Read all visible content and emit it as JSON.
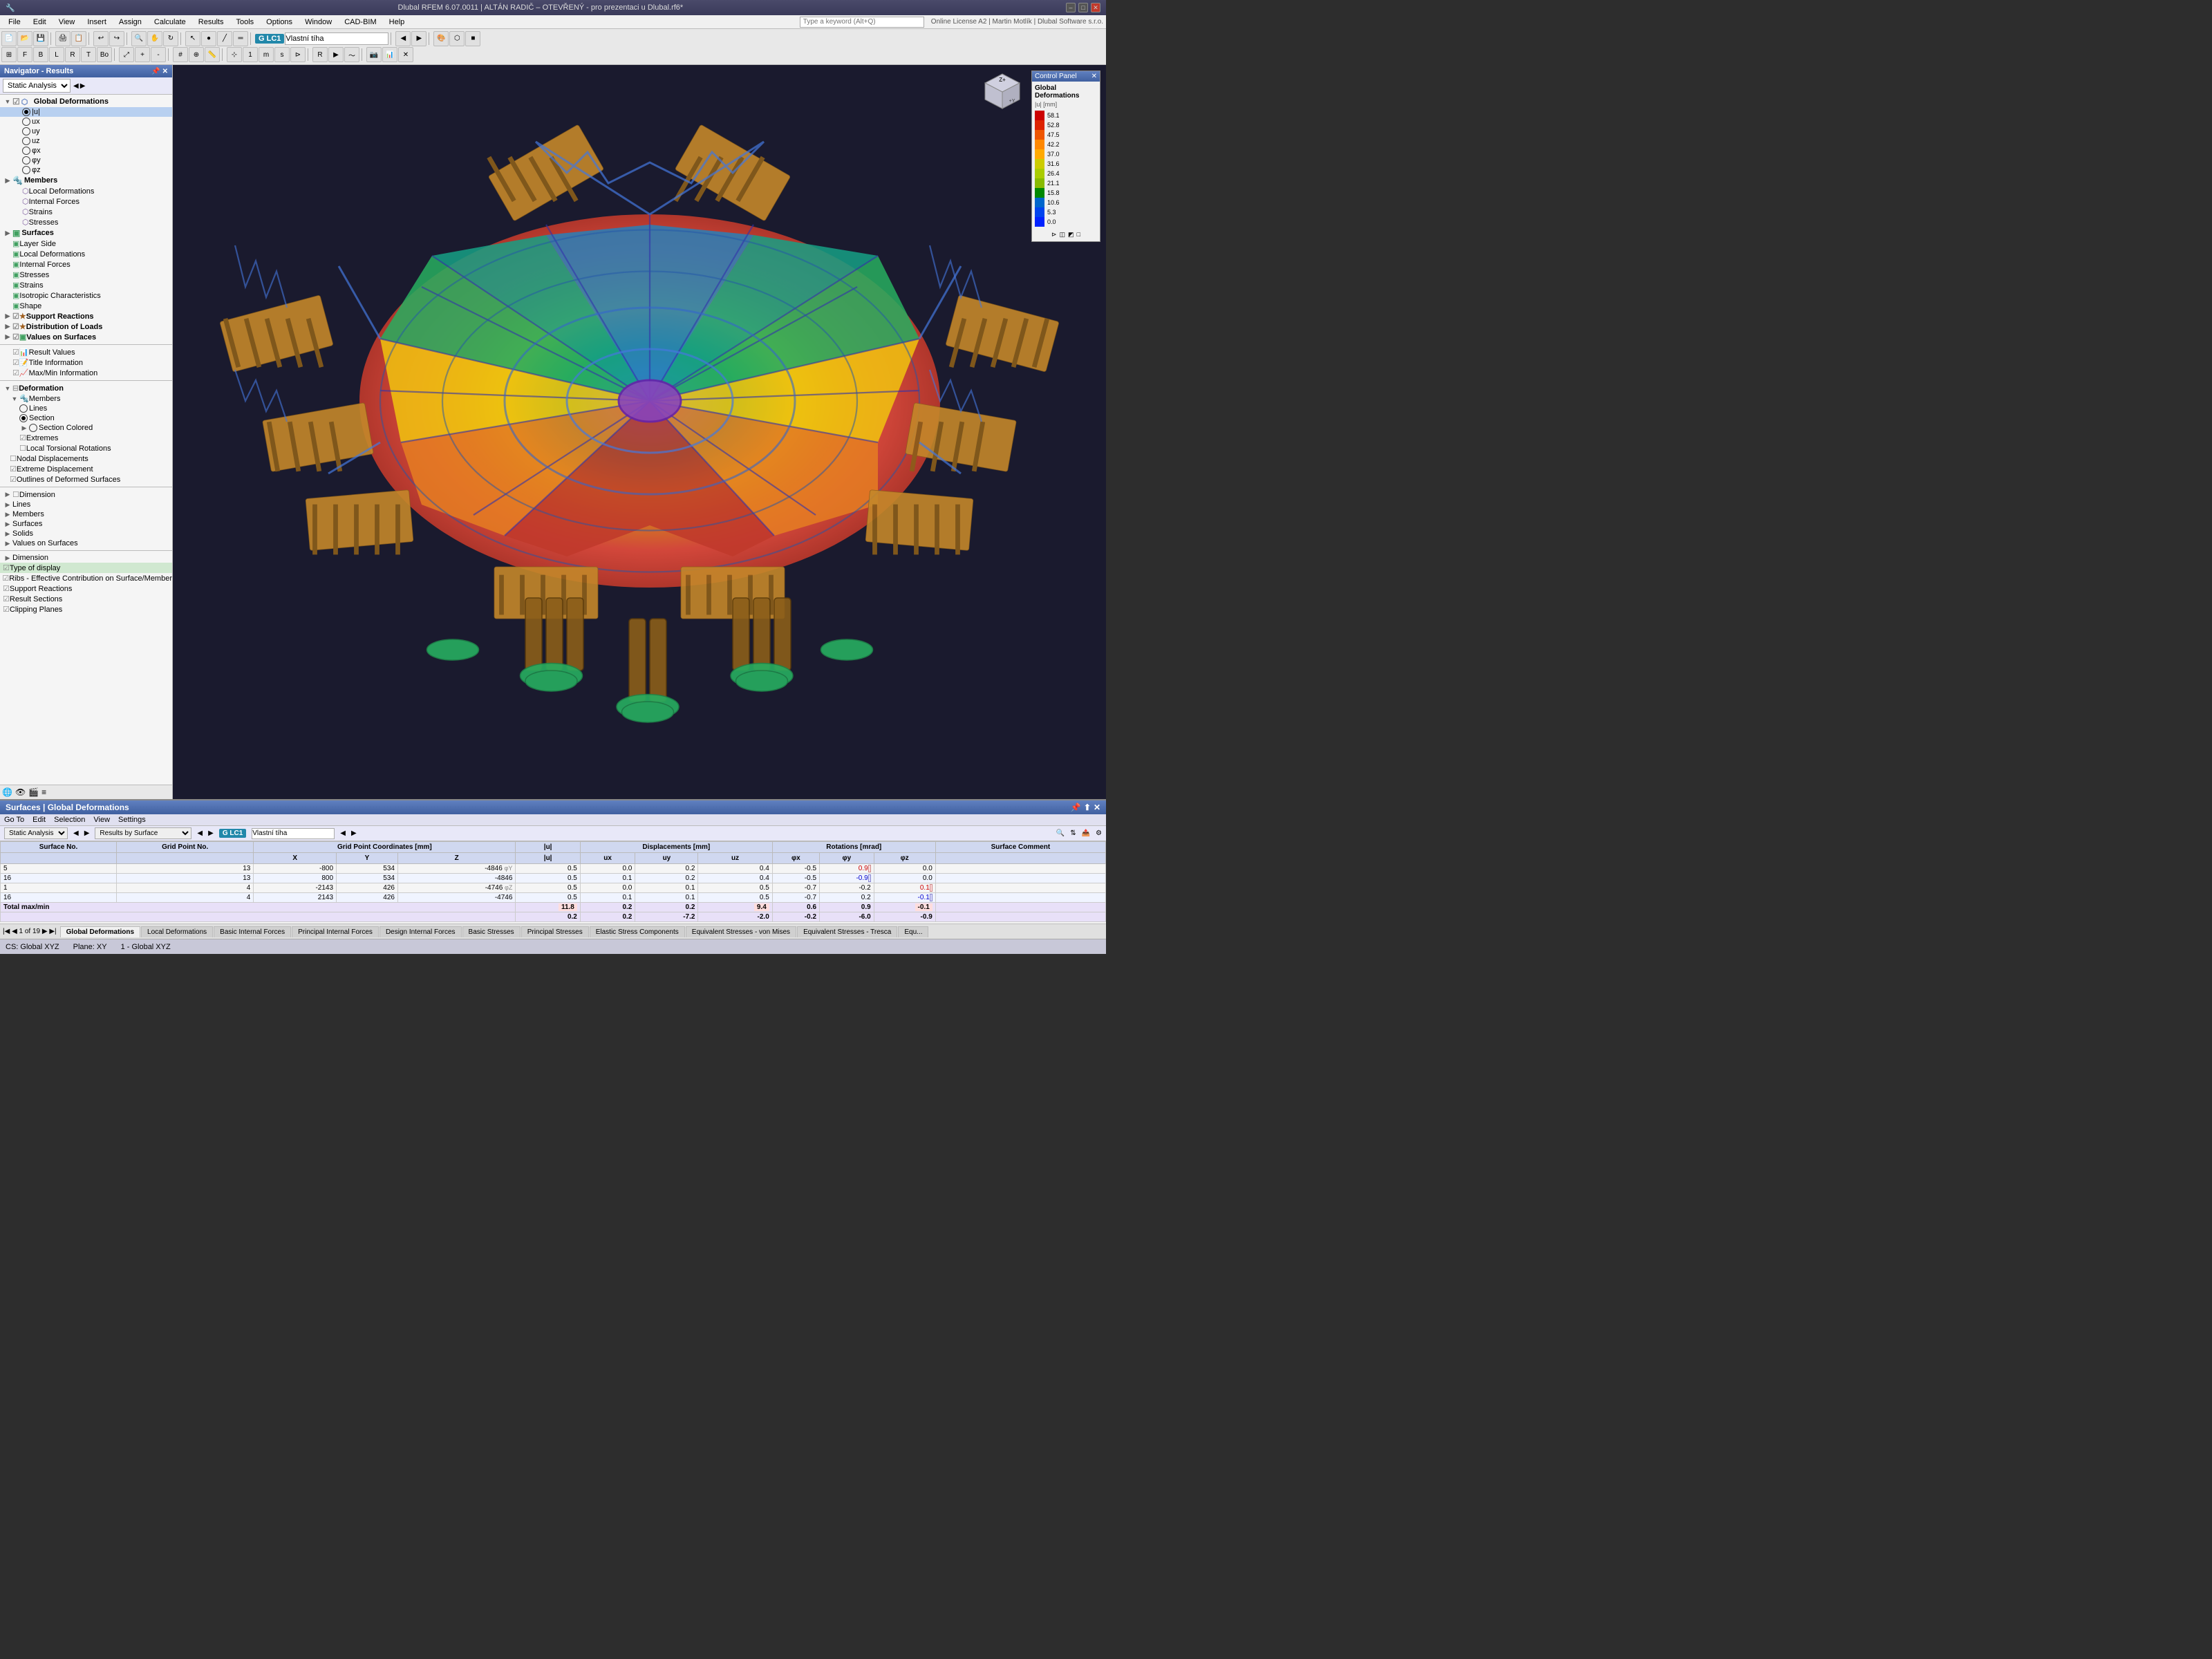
{
  "titleBar": {
    "title": "Dlubal RFEM 6.07.0011 | ALTÁN RADIČ – OTEVŘENÝ - pro prezentaci u Dlubal.rf6*",
    "minimizeLabel": "–",
    "maximizeLabel": "□",
    "closeLabel": "✕"
  },
  "menuBar": {
    "items": [
      "File",
      "Edit",
      "View",
      "Insert",
      "Assign",
      "Calculate",
      "Results",
      "Tools",
      "Options",
      "Window",
      "CAD-BIM",
      "Help"
    ]
  },
  "toolbar": {
    "analysisType": "Static Analysis",
    "loadCase": "LC1",
    "loadName": "Vlastní tíha",
    "searchPlaceholder": "Type a keyword (Alt+Q)"
  },
  "navigator": {
    "title": "Navigator - Results",
    "filterLabel": "Static Analysis",
    "sections": {
      "globalDeformations": {
        "label": "Global Deformations",
        "items": [
          "|u|",
          "ux",
          "uy",
          "uz",
          "φx",
          "φy",
          "φz"
        ]
      },
      "members": {
        "label": "Members",
        "subItems": [
          "Local Deformations",
          "Internal Forces",
          "Strains",
          "Stresses"
        ]
      },
      "surfaces": {
        "label": "Surfaces",
        "subItems": [
          "Layer Side",
          "Local Deformations",
          "Internal Forces",
          "Stresses",
          "Strains",
          "Isotropic Characteristics",
          "Shape"
        ]
      },
      "supportReactions": "Support Reactions",
      "distributionOfLoads": "Distribution of Loads",
      "valuesOnSurfaces": "Values on Surfaces",
      "resultValues": "Result Values",
      "titleInformation": "Title Information",
      "maxMinInformation": "Max/Min Information",
      "deformation": {
        "label": "Deformation",
        "members": {
          "label": "Members",
          "items": [
            "Lines",
            "Section",
            "Section Colored",
            "Extremes",
            "Local Torsional Rotations"
          ]
        },
        "nodal": "Nodal Displacements",
        "extreme": "Extreme Displacement",
        "outlines": "Outlines of Deformed Surfaces"
      },
      "dimension": "Dimension",
      "lines": "Lines",
      "membersNav": "Members",
      "surfaces2": "Surfaces",
      "solids": "Solids",
      "valuesOnSurfaces2": "Values on Surfaces",
      "dimension2": "Dimension",
      "typeOfDisplay": "Type of display",
      "ribs": "Ribs - Effective Contribution on Surface/Member",
      "supportReactions2": "Support Reactions",
      "resultSections": "Result Sections",
      "clippingPlanes": "Clipping Planes"
    }
  },
  "bottomPanel": {
    "title": "Surfaces | Global Deformations",
    "menuItems": [
      "Go To",
      "Edit",
      "Selection",
      "View",
      "Settings"
    ],
    "analysisFilter": "Static Analysis",
    "resultsFilter": "Results by Surface",
    "loadCase": "LC1",
    "loadName": "Vlastní tíha",
    "tableHeaders": {
      "surfaceNo": "Surface No.",
      "gridNo": "Grid Point No.",
      "x": "X",
      "y": "Y",
      "z": "Z",
      "absU": "|u|",
      "ux": "ux",
      "uy": "uy",
      "uz": "uz",
      "phiX": "φx",
      "phiY": "φy",
      "phiZ": "φz",
      "comment": "Surface Comment"
    },
    "tableRows": [
      {
        "surface": "5",
        "grid": "13",
        "x": "-800",
        "y": "534",
        "z": "-4846",
        "note": "φY",
        "absU": "0.5",
        "ux": "0.0",
        "uy": "0.2",
        "uz": "0.4",
        "phiX": "-0.5",
        "phiY": "0.9",
        "phiYColor": "red",
        "phiZ": "0.0"
      },
      {
        "surface": "16",
        "grid": "13",
        "x": "800",
        "y": "534",
        "z": "-4846",
        "note": "",
        "absU": "0.5",
        "ux": "0.1",
        "uy": "0.2",
        "uz": "0.4",
        "phiX": "-0.5",
        "phiY": "-0.9",
        "phiYColor": "blue",
        "phiZ": "0.0"
      },
      {
        "surface": "1",
        "grid": "4",
        "x": "-2143",
        "y": "426",
        "z": "-4746",
        "note": "φZ",
        "absU": "0.5",
        "ux": "0.0",
        "uy": "0.1",
        "uz": "0.5",
        "phiX": "-0.7",
        "phiY": "-0.2",
        "phiYColor": "",
        "phiZ": "0.1",
        "phiZColor": "red"
      },
      {
        "surface": "16",
        "grid": "4",
        "x": "2143",
        "y": "426",
        "z": "-4746",
        "note": "",
        "absU": "0.5",
        "ux": "0.1",
        "uy": "0.1",
        "uz": "0.5",
        "phiX": "-0.7",
        "phiY": "0.2",
        "phiYColor": "",
        "phiZ": "-0.1",
        "phiZColor": "blue"
      }
    ],
    "totalRow": {
      "label": "Total max/min",
      "absU_max": "11.8",
      "absU_min": "0.2",
      "ux_max": "0.2",
      "ux_min": "0.2",
      "uy_max": "0.2",
      "uy_min": "-7.2",
      "uz_max": "9.4",
      "uz_min": "-2.0",
      "phiX_max": "0.6",
      "phiX_min": "-0.2",
      "phiY_max": "0.9",
      "phiY_min": "-6.0",
      "phiZ_max": "-0.1",
      "phiZ_min": "-0.9"
    },
    "units": {
      "coordinates": "mm",
      "displacements": "mm",
      "rotations": "mrad"
    },
    "pagination": {
      "current": "1",
      "total": "19"
    }
  },
  "tabs": [
    "Global Deformations",
    "Local Deformations",
    "Basic Internal Forces",
    "Principal Internal Forces",
    "Design Internal Forces",
    "Basic Stresses",
    "Principal Stresses",
    "Elastic Stress Components",
    "Equivalent Stresses - von Mises",
    "Equivalent Stresses - Tresca",
    "Equ..."
  ],
  "statusBar": {
    "coord": "CS: Global XYZ",
    "plane": "Plane: XY",
    "loadNum": "1 - Global XYZ"
  },
  "controlPanel": {
    "title": "Control Panel",
    "dataTitle": "Global Deformations",
    "unit": "|u| [mm]",
    "scaleValues": [
      "58.1",
      "52.8",
      "47.5",
      "42.2",
      "37.0",
      "31.6",
      "26.4",
      "21.1",
      "15.8",
      "10.6",
      "5.3",
      "0.0"
    ],
    "scaleColors": [
      "#cc0000",
      "#dd2200",
      "#ee5500",
      "#ff8800",
      "#ffaa00",
      "#cccc00",
      "#aacc00",
      "#88bb00",
      "#008800",
      "#0066cc",
      "#0044ee",
      "#0022ff"
    ]
  }
}
